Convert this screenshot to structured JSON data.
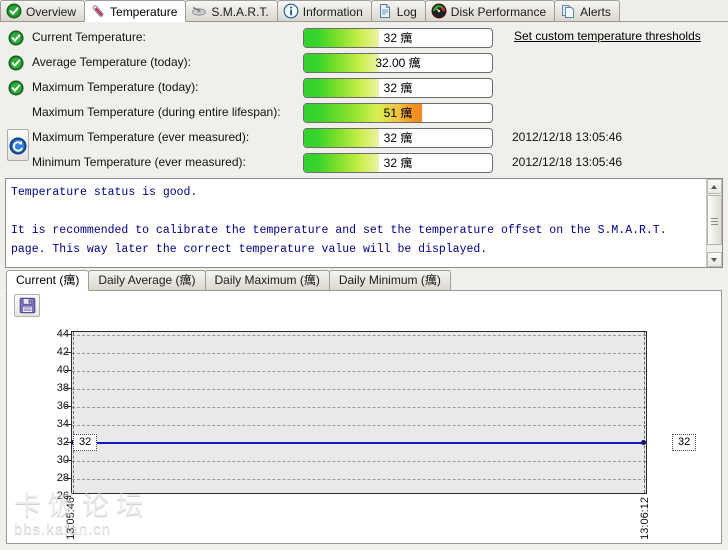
{
  "tabs": [
    {
      "label": "Overview",
      "icon": "green-check-circle-icon",
      "active": false
    },
    {
      "label": "Temperature",
      "icon": "thermometer-icon",
      "active": true
    },
    {
      "label": "S.M.A.R.T.",
      "icon": "smart-disk-icon",
      "active": false
    },
    {
      "label": "Information",
      "icon": "info-circle-icon",
      "active": false
    },
    {
      "label": "Log",
      "icon": "document-icon",
      "active": false
    },
    {
      "label": "Disk Performance",
      "icon": "gauge-icon",
      "active": false
    },
    {
      "label": "Alerts",
      "icon": "copy-pages-icon",
      "active": false
    }
  ],
  "threshold_link": "Set custom temperature thresholds",
  "reset_button_icon": "blue-reset-arrow-icon",
  "rows": [
    {
      "label": "Current Temperature:",
      "status": "ok",
      "value": "32 癘",
      "fill_percent": 40,
      "fill_style": "green",
      "timestamp": ""
    },
    {
      "label": "Average Temperature (today):",
      "status": "ok",
      "value": "32.00 癘",
      "fill_percent": 40,
      "fill_style": "green",
      "timestamp": ""
    },
    {
      "label": "Maximum Temperature (today):",
      "status": "ok",
      "value": "32 癘",
      "fill_percent": 40,
      "fill_style": "green",
      "timestamp": ""
    },
    {
      "label": "Maximum Temperature (during entire lifespan):",
      "status": "none",
      "value": "51 癘",
      "fill_percent": 63,
      "fill_style": "green-orange",
      "timestamp": ""
    },
    {
      "label": "Maximum Temperature (ever measured):",
      "status": "none",
      "value": "32 癘",
      "fill_percent": 40,
      "fill_style": "green",
      "timestamp": "2012/12/18 13:05:46"
    },
    {
      "label": "Minimum Temperature (ever measured):",
      "status": "none",
      "value": "32 癘",
      "fill_percent": 40,
      "fill_style": "green",
      "timestamp": "2012/12/18 13:05:46"
    }
  ],
  "info": {
    "line1": "Temperature status is good.",
    "line2": "It is recommended to calibrate the temperature and set the temperature offset on the S.M.A.R.T. page. This way later the correct temperature value will be displayed.",
    "full_text": "Temperature status is good.\n\nIt is recommended to calibrate the temperature and set the temperature offset on the S.M.A.R.T. page. This way later the correct temperature value will be displayed."
  },
  "subtabs": [
    {
      "label": "Current (癘)",
      "active": true
    },
    {
      "label": "Daily Average (癘)",
      "active": false
    },
    {
      "label": "Daily Maximum (癘)",
      "active": false
    },
    {
      "label": "Daily Minimum (癘)",
      "active": false
    }
  ],
  "save_button_icon": "floppy-save-icon",
  "chart_data": {
    "type": "line",
    "title": "",
    "xlabel": "",
    "ylabel": "",
    "ylim": [
      25,
      45
    ],
    "yticks": [
      44,
      42,
      40,
      38,
      36,
      34,
      32,
      30,
      28,
      26
    ],
    "x": [
      "13:05:46",
      "13:06:12"
    ],
    "xtick_labels": [
      "13:05:46",
      "13:06:12"
    ],
    "series": [
      {
        "name": "Current",
        "color": "#1414cf",
        "values": [
          32,
          32
        ]
      }
    ],
    "point_labels": [
      "32",
      "32"
    ],
    "grid": true,
    "legend": "none"
  },
  "watermark": {
    "line1": "卡饭论坛",
    "line2": "bbs.kafan.cn"
  }
}
